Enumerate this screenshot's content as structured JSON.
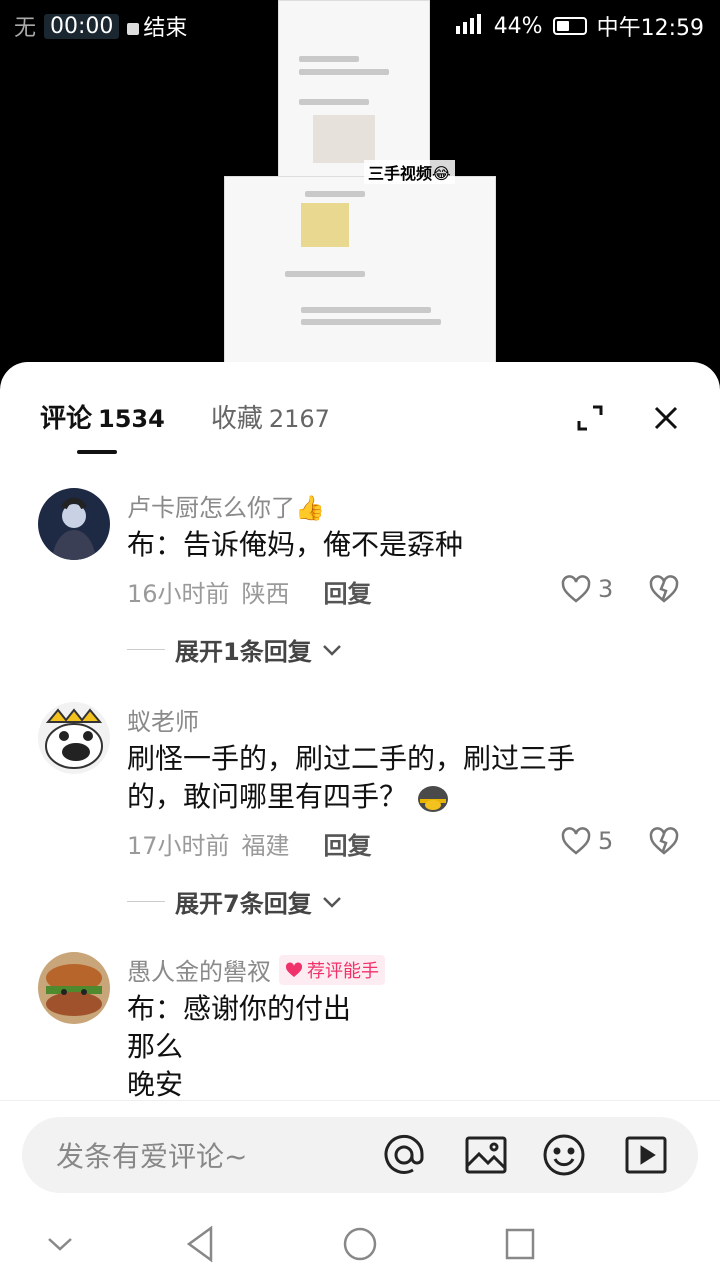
{
  "status_bar": {
    "left_text": "无",
    "timer": "00:00",
    "stop_label": "结束",
    "battery": "44%",
    "time": "中午12:59"
  },
  "video": {
    "caption": "三手视频😂"
  },
  "tabs": [
    {
      "label": "评论",
      "count": "1534"
    },
    {
      "label": "收藏",
      "count": "2167"
    }
  ],
  "comments": [
    {
      "username": "卢卡厨怎么你了👍",
      "lines": [
        "布：告诉俺妈，俺不是孬种"
      ],
      "time": "16小时前",
      "location": "陕西",
      "reply": "回复",
      "likes": "3",
      "expand": "展开1条回复"
    },
    {
      "username": "蚁老师",
      "lines": [
        "刷怪一手的，刷过二手的，刷过三手",
        "的，敢问哪里有四手？"
      ],
      "time": "17小时前",
      "location": "福建",
      "reply": "回复",
      "likes": "5",
      "expand": "展开7条回复"
    },
    {
      "username": "愚人金的嚳衩",
      "badge": "荐评能手",
      "lines": [
        "布：感谢你的付出",
        "那么",
        "晚安"
      ]
    }
  ],
  "input": {
    "placeholder": "发条有爱评论~"
  },
  "colors": {
    "accent": "#f0326b",
    "text": "#111111",
    "muted": "#8a8a8a"
  }
}
